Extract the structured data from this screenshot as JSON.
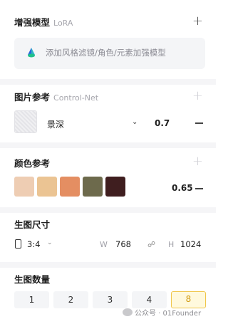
{
  "lora": {
    "title": "增强模型",
    "subtitle": "LoRA",
    "add_icon": "plus-icon",
    "placeholder": "添加风格滤镜/角色/元素加强模型"
  },
  "control_net": {
    "title": "图片参考",
    "subtitle": "Control-Net",
    "mode": "景深",
    "weight": "0.7"
  },
  "color_ref": {
    "title": "颜色参考",
    "colors": [
      "#eecdb3",
      "#ebc493",
      "#e48e62",
      "#6d6a4c",
      "#3f1e1f"
    ],
    "weight": "0.65"
  },
  "size": {
    "title": "生图尺寸",
    "ratio": "3:4",
    "width_label": "W",
    "width": "768",
    "height_label": "H",
    "height": "1024"
  },
  "count": {
    "title": "生图数量",
    "options": [
      "1",
      "2",
      "3",
      "4",
      "8"
    ],
    "selected": "8"
  },
  "watermark": "公众号 · 01Founder"
}
